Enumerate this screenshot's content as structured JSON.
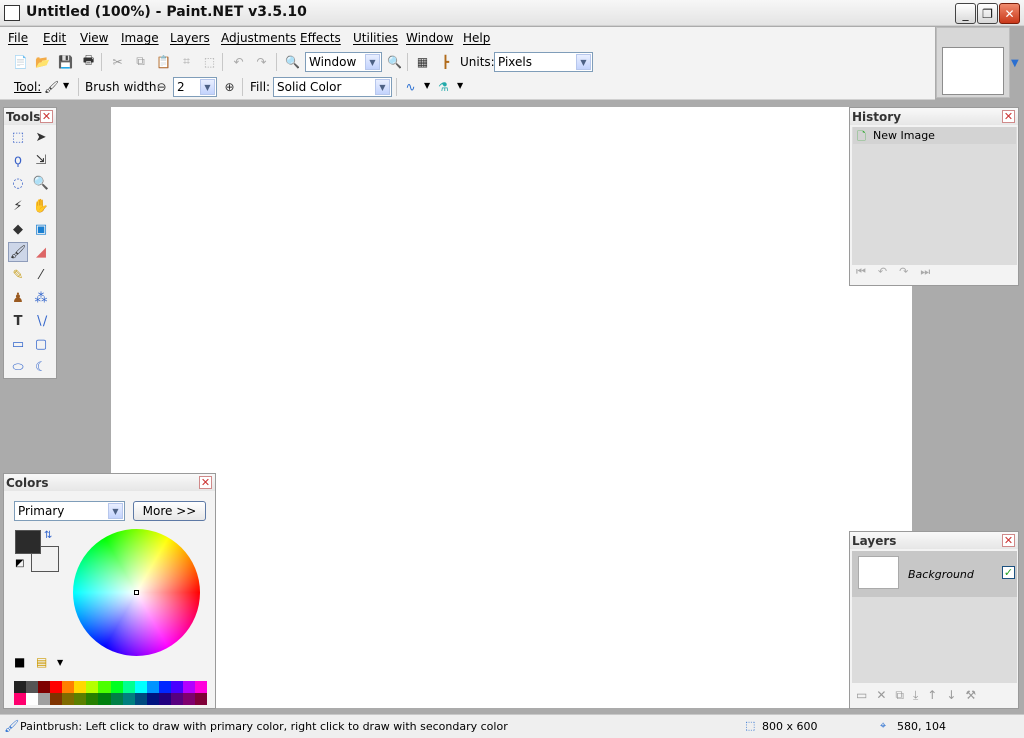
{
  "window": {
    "title": "Untitled (100%) - Paint.NET v3.5.10"
  },
  "menu": [
    "File",
    "Edit",
    "View",
    "Image",
    "Layers",
    "Adjustments",
    "Effects",
    "Utilities",
    "Window",
    "Help"
  ],
  "toolbar": {
    "zoom_value": "Window",
    "units_label": "Units:",
    "units_value": "Pixels",
    "tool_label": "Tool:",
    "brush_width_label": "Brush width:",
    "brush_width_value": "2",
    "fill_label": "Fill:",
    "fill_value": "Solid Color"
  },
  "tools_panel": {
    "title": "Tools",
    "selected": "paintbrush-tool"
  },
  "history_panel": {
    "title": "History",
    "items": [
      "New Image"
    ]
  },
  "colors_panel": {
    "title": "Colors",
    "mode": "Primary",
    "more_label": "More >>",
    "primary_color": "#2b2b2b",
    "secondary_color": "#f2f2f2",
    "palette": [
      "#222222",
      "#555555",
      "#7f0000",
      "#ff0000",
      "#ff7f00",
      "#ffd800",
      "#b6ff00",
      "#4cff00",
      "#00ff21",
      "#00ff90",
      "#00ffff",
      "#0094ff",
      "#0026ff",
      "#4800ff",
      "#b200ff",
      "#ff00dc",
      "#ff006e",
      "#ffffff",
      "#a0a0a0",
      "#7f3300",
      "#7f6a00",
      "#5b7f00",
      "#267f00",
      "#007f0e",
      "#007f46",
      "#007f7f",
      "#004a7f",
      "#00137f",
      "#21007f",
      "#57007f",
      "#7f006e",
      "#7f0037"
    ]
  },
  "layers_panel": {
    "title": "Layers",
    "layer_name": "Background",
    "visible": true
  },
  "status": {
    "hint": "Paintbrush: Left click to draw with primary color, right click to draw with secondary color",
    "image_size": "800 x 600",
    "cursor_pos": "580, 104"
  }
}
